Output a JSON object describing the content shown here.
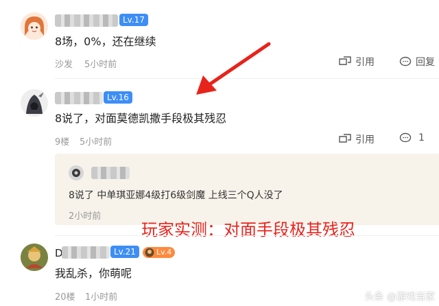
{
  "comments": [
    {
      "level": "Lv.17",
      "text": "8场，0%，还在继续",
      "meta_left": "沙发",
      "time": "5小时前",
      "quote_label": "引用",
      "reply_label": "回复"
    },
    {
      "level": "Lv.16",
      "text": "8说了，对面莫德凯撒手段极其残忍",
      "meta_left": "9楼",
      "time": "5小时前",
      "quote_label": "引用",
      "reply_count": "1",
      "nested_reply": {
        "text": "8说了 中单琪亚娜4级打6级剑魔 上线三个Q人没了",
        "time": "2小时前"
      }
    },
    {
      "level": "Lv.21",
      "badge": "Lv.4",
      "text": "我乱杀，你萌呢",
      "meta_left": "20楼",
      "time": "1小时前"
    }
  ],
  "annotation": "玩家实测：对面手段极其残忍",
  "watermark": "头条 @游戏当家",
  "colors": {
    "level_badge": "#3d8ef5",
    "annotation": "#e8231b",
    "quote_bg": "#f7f3eb",
    "arrow": "#e8231b"
  }
}
